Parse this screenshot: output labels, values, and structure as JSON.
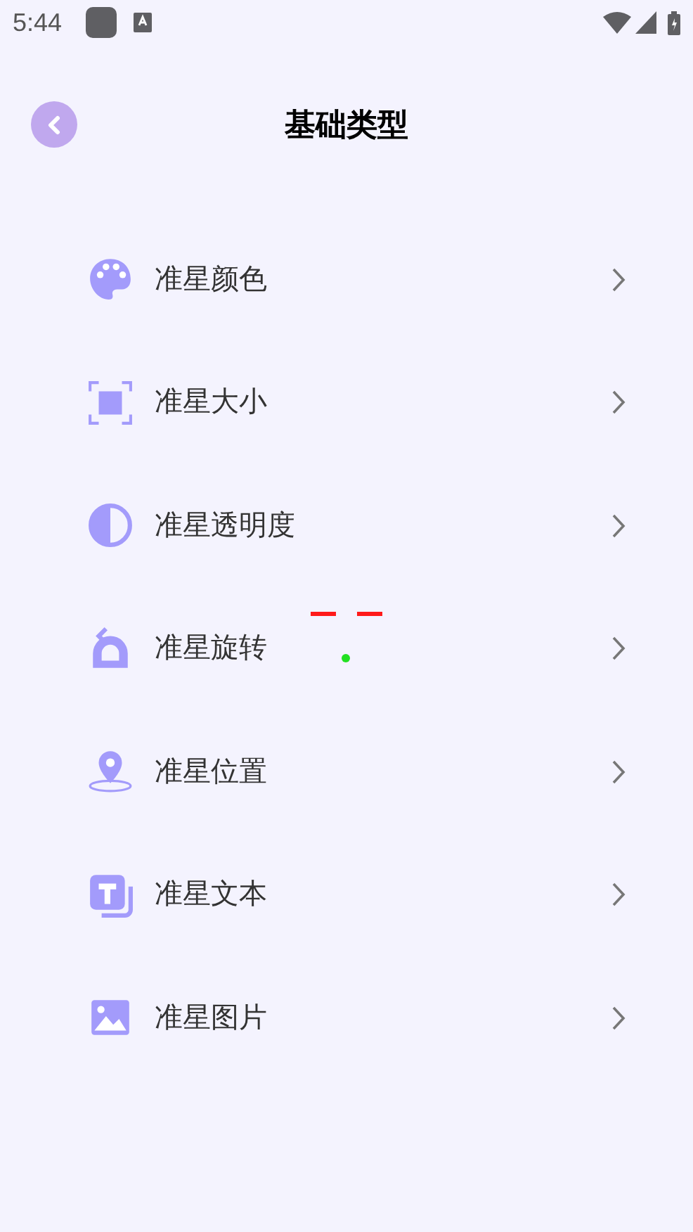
{
  "status_bar": {
    "time": "5:44"
  },
  "header": {
    "title": "基础类型"
  },
  "items": [
    {
      "kind": "color",
      "label": "准星颜色"
    },
    {
      "kind": "size",
      "label": "准星大小"
    },
    {
      "kind": "opacity",
      "label": "准星透明度"
    },
    {
      "kind": "rotation",
      "label": "准星旋转"
    },
    {
      "kind": "position",
      "label": "准星位置"
    },
    {
      "kind": "text",
      "label": "准星文本"
    },
    {
      "kind": "image",
      "label": "准星图片"
    }
  ]
}
